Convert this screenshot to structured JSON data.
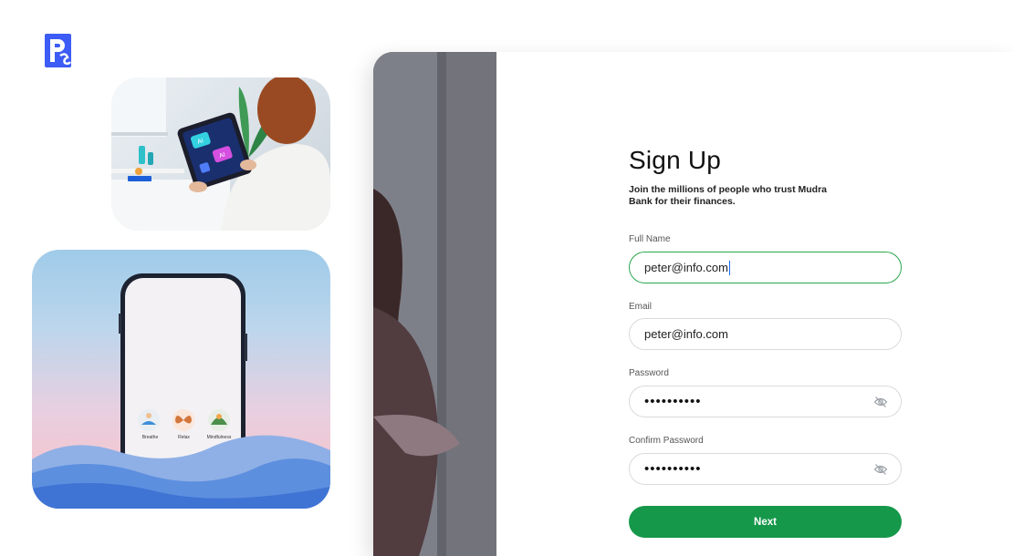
{
  "brand": {
    "logo_icon": "ps-logo-icon",
    "accent": "#3d5cf5"
  },
  "signup": {
    "title": "Sign Up",
    "subtitle": "Join the millions of people who trust Mudra Bank for their finances.",
    "fields": {
      "full_name": {
        "label": "Full Name",
        "value": "peter@info.com",
        "focused": true
      },
      "email": {
        "label": "Email",
        "value": "peter@info.com"
      },
      "password": {
        "label": "Password",
        "value": "••••••••••",
        "icon": "eye-off-icon"
      },
      "confirm_password": {
        "label": "Confirm Password",
        "value": "••••••••••",
        "icon": "eye-off-icon"
      }
    },
    "next_label": "Next",
    "colors": {
      "primary": "#16984a",
      "focus_border": "#2aa84e"
    }
  },
  "phone_card": {
    "apps": [
      {
        "label": "Breathe",
        "icon": "meditation-icon"
      },
      {
        "label": "Relax",
        "icon": "butterfly-icon"
      },
      {
        "label": "Mindfulness",
        "icon": "lotus-icon"
      }
    ]
  },
  "tablet_card": {
    "screen_badges": [
      "AI",
      "AI"
    ]
  }
}
